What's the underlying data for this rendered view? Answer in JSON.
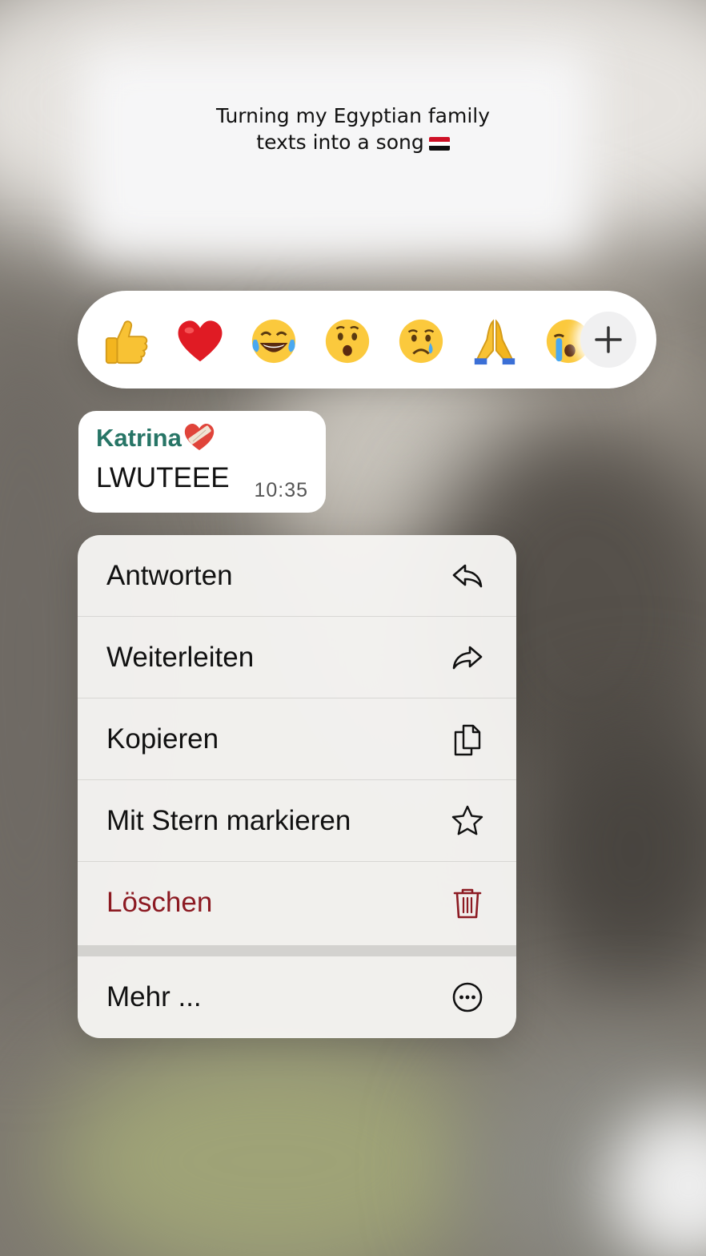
{
  "caption": {
    "line1": "Turning my Egyptian family",
    "line2": "texts into a song",
    "flag_icon": "egypt-flag-icon"
  },
  "reactions": {
    "emojis": [
      "thumbs-up",
      "red-heart",
      "tears-of-joy",
      "surprised-face",
      "crying-face",
      "folded-hands",
      "loudly-crying-face"
    ],
    "more_button_icon": "plus-icon"
  },
  "message": {
    "sender": "Katrina",
    "sender_badge_icon": "mending-heart-icon",
    "text": "LWUTEEE",
    "time": "10:35",
    "sender_color": "#277566"
  },
  "menu": {
    "items": [
      {
        "label": "Antworten",
        "icon": "reply-icon"
      },
      {
        "label": "Weiterleiten",
        "icon": "forward-icon"
      },
      {
        "label": "Kopieren",
        "icon": "copy-icon"
      },
      {
        "label": "Mit Stern markieren",
        "icon": "star-icon"
      },
      {
        "label": "Löschen",
        "icon": "trash-icon",
        "color": "#8c1a22"
      }
    ],
    "more": {
      "label": "Mehr ...",
      "icon": "ellipsis-circle-icon"
    }
  }
}
